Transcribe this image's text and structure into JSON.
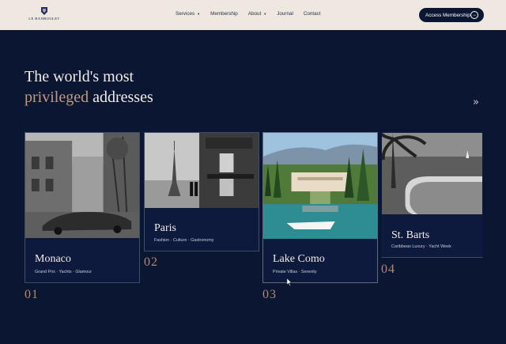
{
  "header": {
    "logo_text": "LE BANBOULET",
    "nav": [
      {
        "label": "Services",
        "dropdown": true
      },
      {
        "label": "Membership",
        "dropdown": false
      },
      {
        "label": "About",
        "dropdown": true
      },
      {
        "label": "Journal",
        "dropdown": false
      },
      {
        "label": "Contact",
        "dropdown": false
      }
    ],
    "cta_label": "Access Membership",
    "cta_icon": "arrow-circle-icon"
  },
  "hero": {
    "line1": "The world's most",
    "accent": "privileged",
    "line2_rest": " addresses",
    "next_icon": "double-chevron-right-icon"
  },
  "destinations": [
    {
      "title": "Monaco",
      "subtitle": "Grand Prix · Yachts · Glamour",
      "number": "01"
    },
    {
      "title": "Paris",
      "subtitle": "Fashion · Culture · Gastronomy",
      "number": "02"
    },
    {
      "title": "Lake Como",
      "subtitle": "Private Villas · Serenity",
      "number": "03"
    },
    {
      "title": "St. Barts",
      "subtitle": "Caribbean Luxury · Yacht Week",
      "number": "04"
    }
  ],
  "colors": {
    "background": "#0b1633",
    "header_bg": "#efe8e1",
    "accent": "#c39b7d",
    "number_color": "#b48a6c"
  }
}
